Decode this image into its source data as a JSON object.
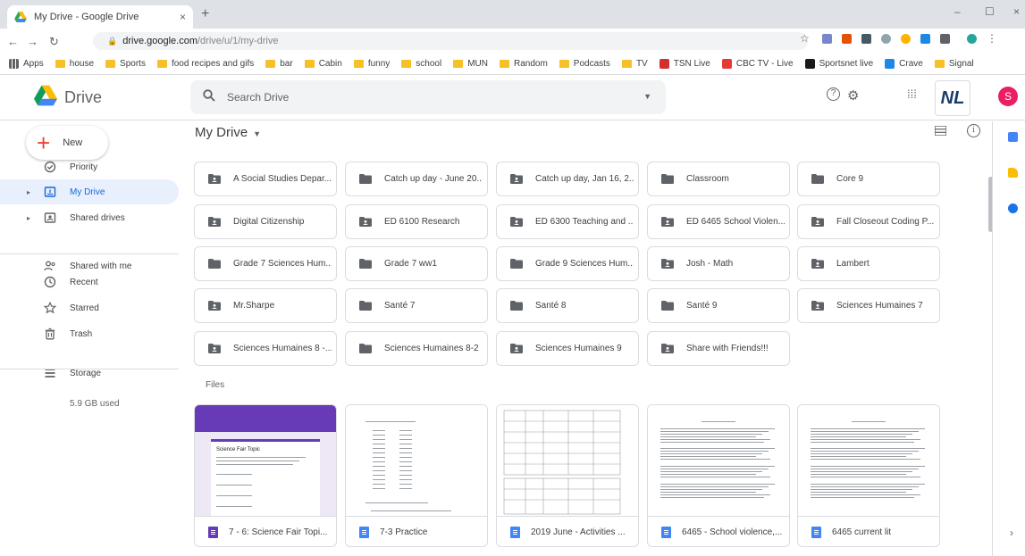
{
  "browser": {
    "tab_title": "My Drive - Google Drive",
    "tab_close": "×",
    "new_tab": "+",
    "window_controls": {
      "minimize": "–",
      "maximize": "☐",
      "close": "×"
    },
    "url_host": "drive.google.com",
    "url_path": "/drive/u/1/my-drive",
    "bookmarks": [
      {
        "label": "Apps",
        "type": "apps"
      },
      {
        "label": "house",
        "type": "folder"
      },
      {
        "label": "Sports",
        "type": "folder"
      },
      {
        "label": "food recipes and gifs",
        "type": "folder"
      },
      {
        "label": "bar",
        "type": "folder"
      },
      {
        "label": "Cabin",
        "type": "folder"
      },
      {
        "label": "funny",
        "type": "folder"
      },
      {
        "label": "school",
        "type": "folder"
      },
      {
        "label": "MUN",
        "type": "folder"
      },
      {
        "label": "Random",
        "type": "folder"
      },
      {
        "label": "Podcasts",
        "type": "folder"
      },
      {
        "label": "TV",
        "type": "folder"
      },
      {
        "label": "TSN Live",
        "type": "site",
        "color": "#d32f2f"
      },
      {
        "label": "CBC TV - Live",
        "type": "site",
        "color": "#e53935"
      },
      {
        "label": "Sportsnet live",
        "type": "site",
        "color": "#1a1a1a"
      },
      {
        "label": "Crave",
        "type": "site",
        "color": "#1e88e5"
      },
      {
        "label": "Signal",
        "type": "folder"
      }
    ]
  },
  "header": {
    "product": "Drive",
    "search_placeholder": "Search Drive",
    "brand_badge": "NL",
    "avatar_letter": "S"
  },
  "sidebar": {
    "new_label": "New",
    "items": [
      {
        "label": "Priority",
        "icon": "priority-icon"
      },
      {
        "label": "My Drive",
        "icon": "my-drive-icon",
        "active": true
      },
      {
        "label": "Shared drives",
        "icon": "shared-drives-icon"
      },
      {
        "label": "Shared with me",
        "icon": "shared-with-me-icon"
      },
      {
        "label": "Recent",
        "icon": "clock-icon"
      },
      {
        "label": "Starred",
        "icon": "star-icon"
      },
      {
        "label": "Trash",
        "icon": "trash-icon"
      },
      {
        "label": "Storage",
        "icon": "storage-icon"
      }
    ],
    "storage_used": "5.9 GB used"
  },
  "main": {
    "title": "My Drive",
    "folders": [
      {
        "name": "A Social Studies Depar...",
        "shared": true
      },
      {
        "name": "Catch up day - June 20...",
        "shared": false
      },
      {
        "name": "Catch up day, Jan 16, 2...",
        "shared": true
      },
      {
        "name": "Classroom",
        "shared": false
      },
      {
        "name": "Core 9",
        "shared": false
      },
      {
        "name": "Digital Citizenship",
        "shared": true
      },
      {
        "name": "ED 6100 Research",
        "shared": true
      },
      {
        "name": "ED 6300 Teaching and ...",
        "shared": true
      },
      {
        "name": "ED 6465 School Violen...",
        "shared": true
      },
      {
        "name": "Fall Closeout Coding P...",
        "shared": true
      },
      {
        "name": "Grade 7 Sciences Hum...",
        "shared": false
      },
      {
        "name": "Grade 7 ww1",
        "shared": false
      },
      {
        "name": "Grade 9 Sciences Hum...",
        "shared": false
      },
      {
        "name": "Josh - Math",
        "shared": true
      },
      {
        "name": "Lambert",
        "shared": true
      },
      {
        "name": "Mr.Sharpe",
        "shared": true
      },
      {
        "name": "Santé 7",
        "shared": false
      },
      {
        "name": "Santé 8",
        "shared": false
      },
      {
        "name": "Santé 9",
        "shared": false
      },
      {
        "name": "Sciences Humaines 7",
        "shared": true
      },
      {
        "name": "Sciences Humaines 8 -...",
        "shared": true
      },
      {
        "name": "Sciences Humaines 8-2",
        "shared": false
      },
      {
        "name": "Sciences Humaines 9",
        "shared": true
      },
      {
        "name": "Share with Friends!!!",
        "shared": true
      }
    ],
    "files_label": "Files",
    "files": [
      {
        "name": "7 - 6: Science Fair Topi...",
        "type": "form",
        "color": "#673ab7",
        "thumb": "form",
        "thumb_title": "Science Fair Topic"
      },
      {
        "name": "7-3 Practice",
        "type": "doc",
        "color": "#4285f4",
        "thumb": "list"
      },
      {
        "name": "2019 June - Activities ...",
        "type": "doc",
        "color": "#4285f4",
        "thumb": "table"
      },
      {
        "name": "6465 - School violence,...",
        "type": "doc",
        "color": "#4285f4",
        "thumb": "text"
      },
      {
        "name": "6465 current lit",
        "type": "doc",
        "color": "#4285f4",
        "thumb": "text"
      }
    ]
  },
  "colors": {
    "accent_blue": "#1967d2",
    "active_bg": "#e8f0fe",
    "folder_grey": "#5f6368",
    "new_plus_red": "#ea4335",
    "form_purple": "#673ab7",
    "doc_blue": "#4285f4"
  }
}
